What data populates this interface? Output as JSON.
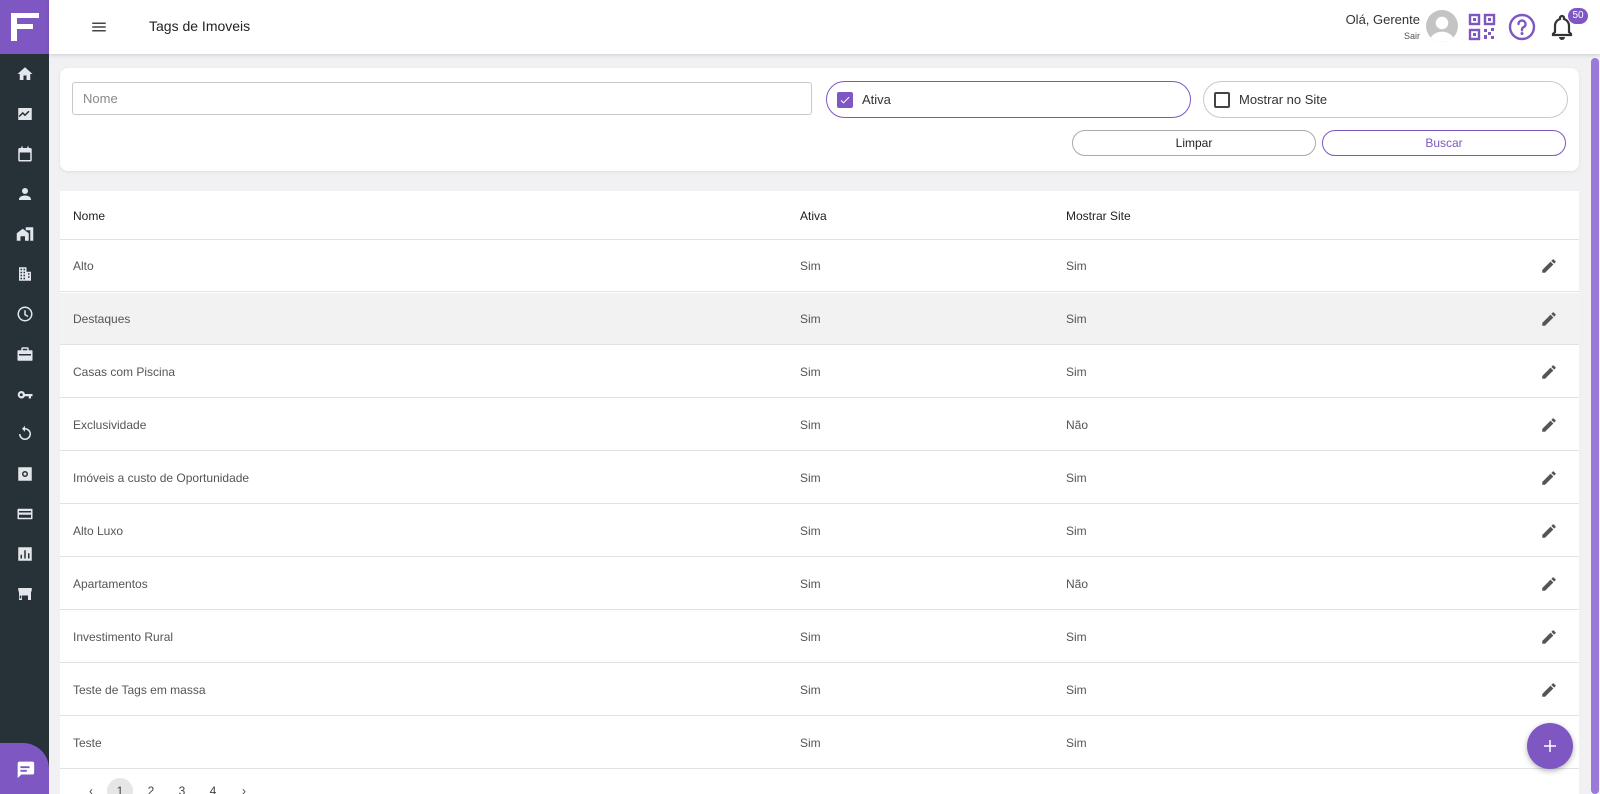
{
  "header": {
    "title": "Tags de Imoveis",
    "greeting": "Olá, Gerente",
    "logout": "Sair",
    "notifications_count": "50",
    "accent_color": "#7e57c2"
  },
  "sidebar": {
    "items": [
      {
        "icon": "home-icon"
      },
      {
        "icon": "trending-up-icon"
      },
      {
        "icon": "calendar-icon"
      },
      {
        "icon": "person-icon"
      },
      {
        "icon": "real-estate-icon"
      },
      {
        "icon": "building-icon"
      },
      {
        "icon": "clock-icon"
      },
      {
        "icon": "briefcase-icon"
      },
      {
        "icon": "key-icon"
      },
      {
        "icon": "refresh-icon"
      },
      {
        "icon": "settings-icon"
      },
      {
        "icon": "credit-card-icon"
      },
      {
        "icon": "bar-chart-icon"
      },
      {
        "icon": "store-icon"
      }
    ]
  },
  "filters": {
    "name_placeholder": "Nome",
    "name_value": "",
    "ativa_label": "Ativa",
    "ativa_checked": true,
    "site_label": "Mostrar no Site",
    "site_checked": false,
    "clear_label": "Limpar",
    "search_label": "Buscar"
  },
  "table": {
    "headers": {
      "nome": "Nome",
      "ativa": "Ativa",
      "site": "Mostrar Site"
    },
    "rows": [
      {
        "nome": "Alto",
        "ativa": "Sim",
        "site": "Sim"
      },
      {
        "nome": "Destaques",
        "ativa": "Sim",
        "site": "Sim"
      },
      {
        "nome": "Casas com Piscina",
        "ativa": "Sim",
        "site": "Sim"
      },
      {
        "nome": "Exclusividade",
        "ativa": "Sim",
        "site": "Não"
      },
      {
        "nome": "Imóveis a custo de Oportunidade",
        "ativa": "Sim",
        "site": "Sim"
      },
      {
        "nome": "Alto Luxo",
        "ativa": "Sim",
        "site": "Sim"
      },
      {
        "nome": "Apartamentos",
        "ativa": "Sim",
        "site": "Não"
      },
      {
        "nome": "Investimento Rural",
        "ativa": "Sim",
        "site": "Sim"
      },
      {
        "nome": "Teste de Tags em massa",
        "ativa": "Sim",
        "site": "Sim"
      },
      {
        "nome": "Teste",
        "ativa": "Sim",
        "site": "Sim"
      }
    ]
  },
  "pagination": {
    "prev": "‹",
    "pages": [
      "1",
      "2",
      "3",
      "4"
    ],
    "current": "1",
    "next": "›"
  }
}
